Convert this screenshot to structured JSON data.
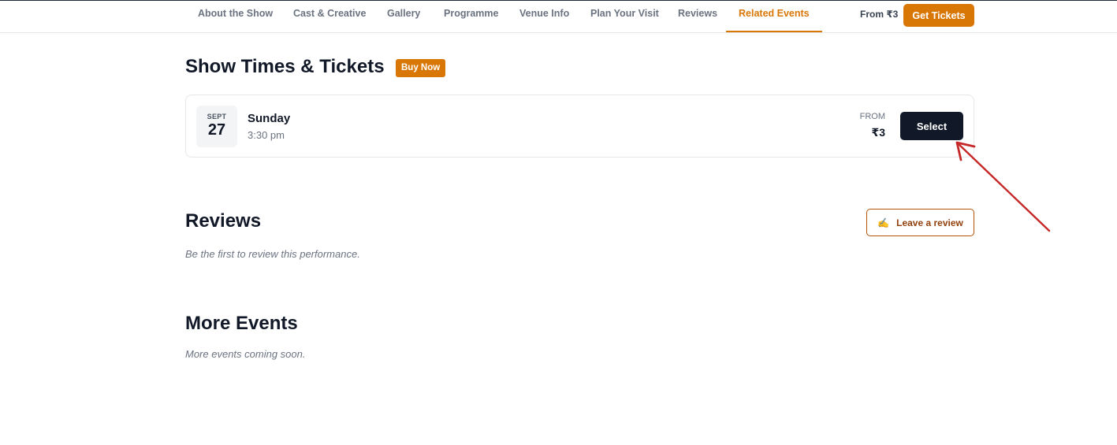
{
  "nav": {
    "tabs": [
      {
        "label": "About the Show"
      },
      {
        "label": "Cast & Creative"
      },
      {
        "label": "Gallery"
      },
      {
        "label": "Programme"
      },
      {
        "label": "Venue Info"
      },
      {
        "label": "Plan Your Visit"
      },
      {
        "label": "Reviews"
      },
      {
        "label": "Related Events",
        "active": true
      }
    ],
    "from_text": "From ₹3",
    "cta_label": "Get Tickets"
  },
  "showtimes": {
    "title": "Show Times & Tickets",
    "badge": "Buy Now",
    "items": [
      {
        "month": "SEPT",
        "day": "27",
        "weekday": "Sunday",
        "time": "3:30 pm",
        "from_label": "FROM",
        "price": "₹3",
        "select_label": "Select"
      }
    ]
  },
  "reviews": {
    "title": "Reviews",
    "button_icon": "writing-hand-icon",
    "button_label": "Leave a review",
    "empty_text": "Be the first to review this performance."
  },
  "more_events": {
    "title": "More Events",
    "empty_text": "More events coming soon."
  },
  "colors": {
    "accent": "#d97706",
    "dark": "#111827",
    "annotation_arrow": "#c62828"
  }
}
